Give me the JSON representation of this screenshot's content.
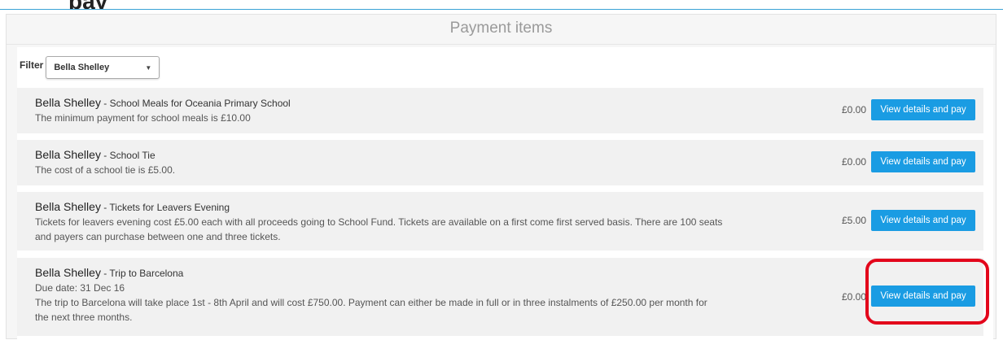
{
  "page": {
    "title_fragment": "pay"
  },
  "panel": {
    "header": "Payment items"
  },
  "filter": {
    "label": "Filter",
    "selected": "Bella Shelley"
  },
  "items": [
    {
      "name": "Bella Shelley",
      "separator": " - ",
      "title": "School Meals for Oceania Primary School",
      "lines": [
        "The minimum payment for school meals is £10.00"
      ],
      "amount": "£0.00",
      "button": "View details and pay"
    },
    {
      "name": "Bella Shelley",
      "separator": " - ",
      "title": "School Tie",
      "lines": [
        "The cost of a school tie is £5.00."
      ],
      "amount": "£0.00",
      "button": "View details and pay"
    },
    {
      "name": "Bella Shelley",
      "separator": " - ",
      "title": "Tickets for Leavers Evening",
      "lines": [
        "Tickets for leavers evening cost £5.00 each with all proceeds going to School Fund. Tickets are available on a first come first served basis. There are 100 seats",
        "and payers can purchase between one and three tickets."
      ],
      "amount": "£5.00",
      "button": "View details and pay"
    },
    {
      "name": "Bella Shelley",
      "separator": " - ",
      "title": "Trip to Barcelona",
      "lines": [
        "Due date: 31 Dec 16",
        "The trip to Barcelona will take place 1st - 8th April and will cost £750.00. Payment can either be made in full or in three instalments of £250.00 per month for",
        "the next three months."
      ],
      "amount": "£0.00",
      "button": "View details and pay"
    }
  ],
  "colors": {
    "button": "#1a9ce3",
    "highlight": "#e3061b",
    "rule": "#3ba3d6"
  }
}
